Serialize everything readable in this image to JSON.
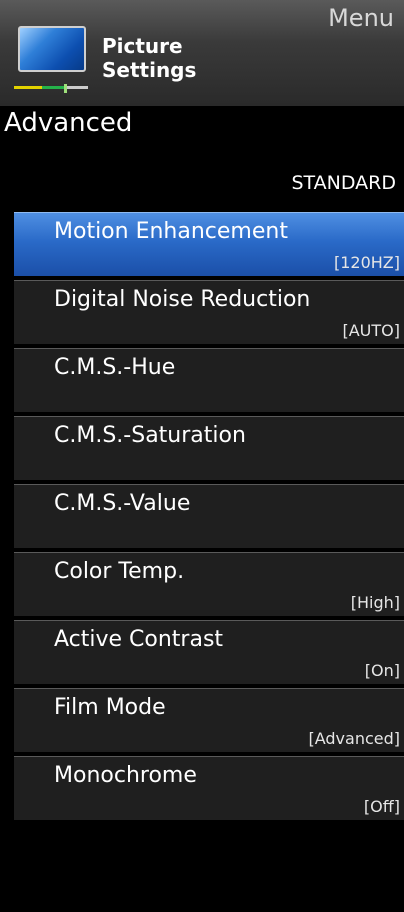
{
  "header": {
    "menu_label": "Menu",
    "title_line1": "Picture",
    "title_line2": "Settings",
    "icon": "tv-picture-icon"
  },
  "section_title": "Advanced",
  "mode_label": "STANDARD",
  "items": [
    {
      "label": "Motion Enhancement",
      "value": "[120HZ]",
      "selected": true
    },
    {
      "label": "Digital Noise Reduction",
      "value": "[AUTO]"
    },
    {
      "label": "C.M.S.-Hue",
      "value": ""
    },
    {
      "label": "C.M.S.-Saturation",
      "value": ""
    },
    {
      "label": "C.M.S.-Value",
      "value": ""
    },
    {
      "label": "Color Temp.",
      "value": "[High]"
    },
    {
      "label": "Active Contrast",
      "value": "[On]"
    },
    {
      "label": "Film Mode",
      "value": "[Advanced]"
    },
    {
      "label": "Monochrome",
      "value": "[Off]"
    }
  ],
  "colors": {
    "selected_start": "#4f8fe2",
    "selected_end": "#1b4fa8",
    "item_bg": "#1f1f1f",
    "background": "#000000"
  }
}
